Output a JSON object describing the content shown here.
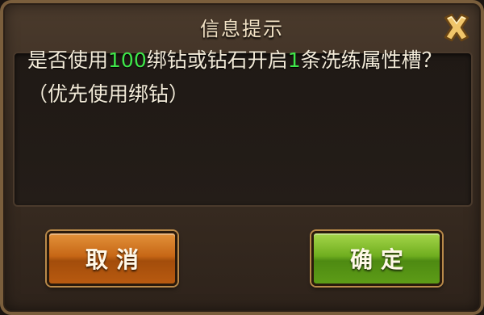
{
  "dialog": {
    "title": "信息提示",
    "message": {
      "part1": "是否使用",
      "amount": "100",
      "part2": "绑钻或钻石开启",
      "count": "1",
      "part3": "条洗练属性槽？（优先使用绑钻）"
    },
    "cancel_label": "取消",
    "confirm_label": "确定",
    "close_icon": "close-icon"
  },
  "colors": {
    "highlight": "#3fe64a",
    "cancel_button": "#c76716",
    "confirm_button": "#6fae1f",
    "title_text": "#f3e3c6"
  }
}
